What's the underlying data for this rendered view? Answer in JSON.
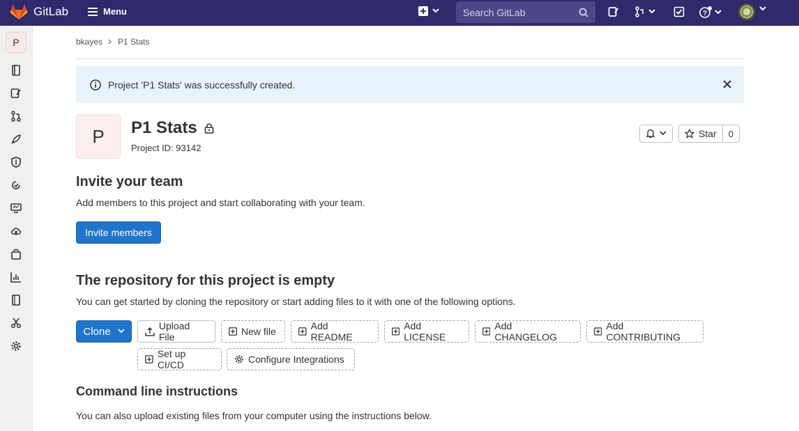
{
  "topbar": {
    "brand": "GitLab",
    "menu_label": "Menu",
    "search_placeholder": "Search GitLab"
  },
  "breadcrumb": {
    "owner": "bkayes",
    "project": "P1 Stats"
  },
  "alert": {
    "message": "Project 'P1 Stats' was successfully created."
  },
  "project": {
    "avatar_letter": "P",
    "name": "P1 Stats",
    "id_text": "Project ID: 93142",
    "star_label": "Star",
    "star_count": "0"
  },
  "invite": {
    "heading": "Invite your team",
    "description": "Add members to this project and start collaborating with your team.",
    "button": "Invite members"
  },
  "empty_repo": {
    "heading": "The repository for this project is empty",
    "description": "You can get started by cloning the repository or start adding files to it with one of the following options.",
    "clone": "Clone",
    "upload": "Upload File",
    "new_file": "New file",
    "add_readme": "Add README",
    "add_license": "Add LICENSE",
    "add_changelog": "Add CHANGELOG",
    "add_contributing": "Add CONTRIBUTING",
    "setup_ci": "Set up CI/CD",
    "configure_integrations": "Configure Integrations"
  },
  "cli": {
    "heading": "Command line instructions",
    "description": "You can also upload existing files from your computer using the instructions below."
  },
  "sidebar": {
    "project_letter": "P"
  },
  "colors": {
    "topbar": "#2f2a6b",
    "primary": "#1f75cb",
    "alert_bg": "#e9f3fc"
  }
}
